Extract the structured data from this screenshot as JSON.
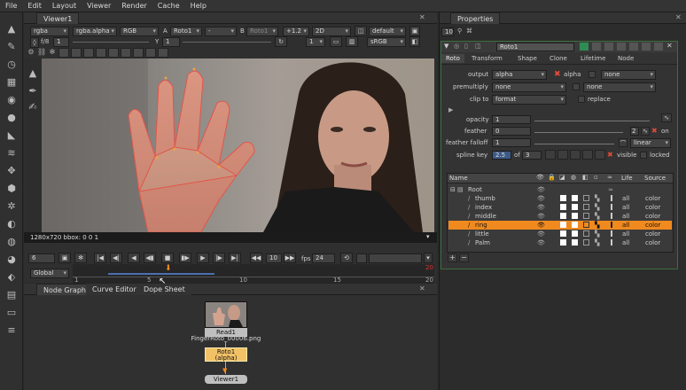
{
  "menu": [
    "File",
    "Edit",
    "Layout",
    "Viewer",
    "Render",
    "Cache",
    "Help"
  ],
  "viewer_tab": "Viewer1",
  "viewer_controls": {
    "channels": "rgba",
    "channel_alpha": "rgba.alpha",
    "display": "RGB",
    "a_label": "A",
    "a_input": "Roto1",
    "a_op": "-",
    "b_label": "B",
    "b_input": "Roto1",
    "zoom_factor": "+1.2",
    "mode_2d": "2D",
    "lut": "default",
    "gain_label": "f/8",
    "gain_value": "1",
    "y_label": "Y",
    "gamma_value": "1",
    "colorspace": "sRGB",
    "cursor_value": "1"
  },
  "viewer_status": "1280x720 bbox: 0 0 1",
  "timeline": {
    "frame": "6",
    "step": "10",
    "fps_label": "fps",
    "fps": "24",
    "range_mode": "Global",
    "ticks": [
      "1",
      "5",
      "10",
      "15",
      "20"
    ],
    "end_frame": "20"
  },
  "node_tabs": [
    "Node Graph",
    "Curve Editor",
    "Dope Sheet"
  ],
  "nodes": {
    "read_label": "Read1",
    "read_file": "FingerRoto_00006.png",
    "roto_label": "Roto1",
    "roto_sub": "(alpha)",
    "viewer_label": "Viewer1"
  },
  "properties": {
    "tab": "Properties",
    "max_panels": "10",
    "node_name": "Roto1",
    "tabs": [
      "Roto",
      "Transform",
      "Shape",
      "Clone",
      "Lifetime",
      "Node"
    ],
    "output_label": "output",
    "output_value": "alpha",
    "alpha_check": "alpha",
    "output_extra": "none",
    "premultiply_label": "premultiply",
    "premultiply_value": "none",
    "premultiply_extra": "none",
    "clipto_label": "clip to",
    "clipto_value": "format",
    "replace_label": "replace",
    "opacity_label": "opacity",
    "opacity_value": "1",
    "feather_label": "feather",
    "feather_value": "0",
    "feather_num": "2",
    "on_label": "on",
    "falloff_label": "feather falloff",
    "falloff_value": "1",
    "falloff_type": "linear",
    "splinekey_label": "spline key",
    "splinekey_value": "2.5",
    "of_label": "of",
    "of_value": "3",
    "visible_label": "visible",
    "locked_label": "locked",
    "slider_ticks": [
      "0.1",
      "0.2",
      "0.3",
      "0.4",
      "0.5",
      "0.6",
      "0.7",
      "0.8",
      "0.9"
    ]
  },
  "tree": {
    "col_name": "Name",
    "col_life": "Life",
    "col_source": "Source",
    "rows": [
      {
        "name": "Root",
        "life": "",
        "source": ""
      },
      {
        "name": "thumb",
        "life": "all",
        "source": "color"
      },
      {
        "name": "index",
        "life": "all",
        "source": "color"
      },
      {
        "name": "middle",
        "life": "all",
        "source": "color"
      },
      {
        "name": "ring",
        "life": "all",
        "source": "color"
      },
      {
        "name": "little",
        "life": "all",
        "source": "color"
      },
      {
        "name": "Palm",
        "life": "all",
        "source": "color"
      }
    ],
    "selected_index": 4
  },
  "colors": {
    "accent": "#f08a1e",
    "roto_node": "#f2c166",
    "shape_stroke": "#e2554a"
  }
}
